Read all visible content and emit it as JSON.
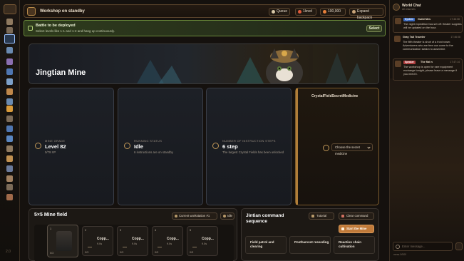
{
  "topbar": {
    "workshop_status": "Workshop on standby",
    "queue_label": "Queue",
    "level_label": "1level",
    "coins": "100,000",
    "expand_backpack": "Expand backpack"
  },
  "banner": {
    "title": "Battle to be deployed",
    "description": "Select levels like 1-1 and 1-2 and hang up continuously.",
    "select_label": "Select"
  },
  "hero": {
    "title": "Jingtian Mine"
  },
  "stats": [
    {
      "label": "MINE GRADE",
      "value": "Level 82",
      "sub": "0/79 XP",
      "icon": "mine-grade-icon"
    },
    {
      "label": "RUNNING STATUS",
      "value": "Idle",
      "sub": "6 instructions are on standby",
      "icon": "status-icon"
    },
    {
      "label": "NUMBER OF INSTRUCTION STEPS",
      "value": "6 step",
      "sub": "The largest Crystal Fields has been unlocked",
      "icon": "steps-icon"
    }
  ],
  "relic": {
    "vertical_text": "CrystalFieldSecretMedicine",
    "select_label": "Choose the secret medicine"
  },
  "mine_field": {
    "title": "5×5 Mine field",
    "workstation_label": "Current workstation #1",
    "idle_label": "Idle",
    "slots": [
      {
        "num": "1",
        "name": "",
        "time": "",
        "count": "0/3"
      },
      {
        "num": "2",
        "name": "Copp...",
        "time": "9.0s",
        "count": "0/3"
      },
      {
        "num": "3",
        "name": "Copp...",
        "time": "9.0s",
        "count": "0/3"
      },
      {
        "num": "4",
        "name": "Copp...",
        "time": "9.0s",
        "count": "0/3"
      },
      {
        "num": "5",
        "name": "Copp...",
        "time": "9.0s",
        "count": "0/3"
      }
    ]
  },
  "command": {
    "title": "Jintian command sequence",
    "tutorial_label": "Tutorial",
    "clear_label": "Clear command",
    "start_label": "Start the Mine",
    "items": [
      "Field patrol and clearing",
      "Postharvest reseeding",
      "Reaction chain cultivation"
    ]
  },
  "chat": {
    "title": "World Chat",
    "subtitle": "All channels",
    "messages": [
      {
        "tag": "System",
        "user": "Guild Mes",
        "time": "17:46:08",
        "body": "The night expedition has set off: theater supplies will be updated on the hour."
      },
      {
        "tag": "",
        "user": "Gray Tail Traveler",
        "time": "17:46:08",
        "body": "The fifth theater is short of a front rower. Adventurers who are free can come to the communication station to assemble."
      },
      {
        "tag": "Speaker",
        "user": "The flat n",
        "time": "17:47:14",
        "body": "The workshop is open for rare equipment exchange tonight, please leave a message if you need it."
      }
    ],
    "input_placeholder": "Enter message...",
    "char_count": "mess 0/500"
  },
  "sidebar_footer": "2.0",
  "colors": {
    "accent_gold": "#c29858",
    "start_button": "#c07a3a",
    "banner_green": "#6a8a3a",
    "active_nav": "#9ac1ff"
  }
}
